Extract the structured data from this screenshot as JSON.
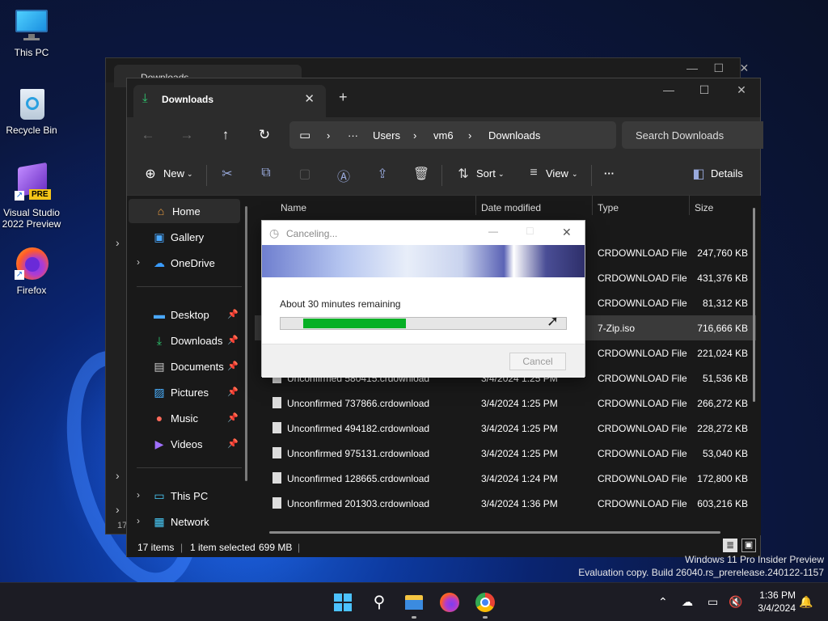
{
  "desktop": {
    "icons": [
      {
        "label": "This PC"
      },
      {
        "label": "Recycle Bin"
      },
      {
        "label": "Visual Studio 2022 Preview",
        "badge": "PRE"
      },
      {
        "label": "Firefox"
      }
    ],
    "watermark": {
      "line1": "Windows 11 Pro Insider Preview",
      "line2": "Evaluation copy. Build 26040.rs_prerelease.240122-1157"
    }
  },
  "back_window": {
    "tab_label": "Downloads",
    "side_fragment": "17"
  },
  "explorer": {
    "tab_label": "Downloads",
    "breadcrumb": [
      "Users",
      "vm6",
      "Downloads"
    ],
    "breadcrumb_overflow": "···",
    "search_placeholder": "Search Downloads",
    "toolbar": {
      "new": "New",
      "sort": "Sort",
      "view": "View",
      "more": "···",
      "details": "Details"
    },
    "sidebar": [
      {
        "label": "Home",
        "icon": "home-icon",
        "selected": true
      },
      {
        "label": "Gallery",
        "icon": "gallery-icon"
      },
      {
        "label": "OneDrive",
        "icon": "onedrive-icon",
        "expandable": true
      },
      {
        "label": "Desktop",
        "icon": "desktop-icon",
        "pinned": true
      },
      {
        "label": "Downloads",
        "icon": "downloads-icon",
        "pinned": true
      },
      {
        "label": "Documents",
        "icon": "documents-icon",
        "pinned": true
      },
      {
        "label": "Pictures",
        "icon": "pictures-icon",
        "pinned": true
      },
      {
        "label": "Music",
        "icon": "music-icon",
        "pinned": true
      },
      {
        "label": "Videos",
        "icon": "videos-icon",
        "pinned": true
      },
      {
        "label": "This PC",
        "icon": "this-pc-icon",
        "expandable": true
      },
      {
        "label": "Network",
        "icon": "network-icon",
        "expandable": true
      }
    ],
    "columns": [
      "Name",
      "Date modified",
      "Type",
      "Size"
    ],
    "rows": [
      {
        "name": "",
        "date": "",
        "type": "CRDOWNLOAD File",
        "size": "247,760 KB"
      },
      {
        "name": "",
        "date": "",
        "type": "CRDOWNLOAD File",
        "size": "431,376 KB"
      },
      {
        "name": "",
        "date": "",
        "type": "CRDOWNLOAD File",
        "size": "81,312 KB"
      },
      {
        "name": "",
        "date": "",
        "type": "7-Zip.iso",
        "size": "716,666 KB",
        "selected": true
      },
      {
        "name": "",
        "date": "",
        "type": "CRDOWNLOAD File",
        "size": "221,024 KB"
      },
      {
        "name": "Unconfirmed 580415.crdownload",
        "date": "3/4/2024 1:25 PM",
        "type": "CRDOWNLOAD File",
        "size": "51,536 KB"
      },
      {
        "name": "Unconfirmed 737866.crdownload",
        "date": "3/4/2024 1:25 PM",
        "type": "CRDOWNLOAD File",
        "size": "266,272 KB"
      },
      {
        "name": "Unconfirmed 494182.crdownload",
        "date": "3/4/2024 1:25 PM",
        "type": "CRDOWNLOAD File",
        "size": "228,272 KB"
      },
      {
        "name": "Unconfirmed 975131.crdownload",
        "date": "3/4/2024 1:25 PM",
        "type": "CRDOWNLOAD File",
        "size": "53,040 KB"
      },
      {
        "name": "Unconfirmed 128665.crdownload",
        "date": "3/4/2024 1:24 PM",
        "type": "CRDOWNLOAD File",
        "size": "172,800 KB"
      },
      {
        "name": "Unconfirmed 201303.crdownload",
        "date": "3/4/2024 1:36 PM",
        "type": "CRDOWNLOAD File",
        "size": "603,216 KB"
      }
    ],
    "status": {
      "count": "17 items",
      "selection": "1 item selected",
      "size": "699 MB"
    }
  },
  "dialog": {
    "title": "Canceling...",
    "message": "About 30 minutes remaining",
    "progress_fraction": 0.36,
    "progress_start_fraction": 0.08,
    "cancel_label": "Cancel",
    "accent_color": "#06b025"
  },
  "taskbar": {
    "apps": [
      "start-icon",
      "search-icon",
      "file-explorer-icon",
      "firefox-icon",
      "chrome-icon"
    ],
    "time": "1:36 PM",
    "date": "3/4/2024"
  }
}
